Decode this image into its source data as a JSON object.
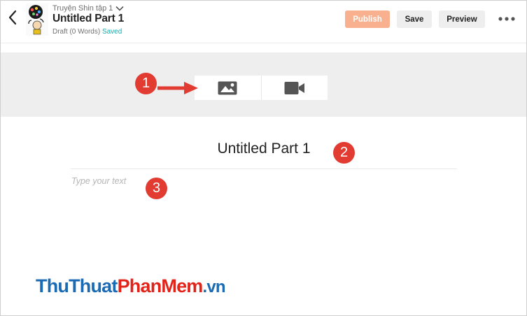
{
  "header": {
    "story_title": "Truyện Shin tập 1",
    "part_title": "Untitled Part 1",
    "status": "Draft (0 Words)",
    "saved": "Saved",
    "publish_label": "Publish",
    "save_label": "Save",
    "preview_label": "Preview"
  },
  "media": {
    "image_icon": "image-icon",
    "video_icon": "video-camera-icon"
  },
  "annotations": {
    "one": "1",
    "two": "2",
    "three": "3"
  },
  "editor": {
    "title": "Untitled Part 1",
    "placeholder": "Type your text"
  },
  "watermark": {
    "part1": "ThuThuat",
    "part2": "PhanMem",
    "part3": ".vn"
  },
  "colors": {
    "publish_bg": "#f8b08f",
    "saved_text": "#00b2b2",
    "badge_red": "#e13b32",
    "media_band": "#eeeeee",
    "watermark_blue": "#1a6ab4",
    "watermark_red": "#e2231a"
  }
}
